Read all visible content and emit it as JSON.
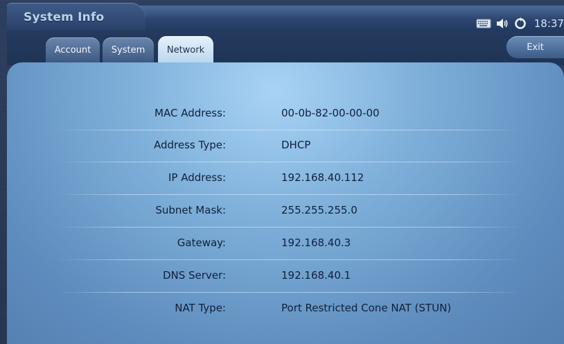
{
  "window": {
    "title": "System Info",
    "time": "18:37",
    "status_icons": [
      "keyboard-icon",
      "speaker-icon",
      "sync-icon"
    ]
  },
  "tabs": [
    {
      "label": "Account",
      "active": false
    },
    {
      "label": "System",
      "active": false
    },
    {
      "label": "Network",
      "active": true
    }
  ],
  "exit_label": "Exit",
  "network": {
    "rows": [
      {
        "label": "MAC Address:",
        "value": "00-0b-82-00-00-00"
      },
      {
        "label": "Address Type:",
        "value": "DHCP"
      },
      {
        "label": "IP Address:",
        "value": "192.168.40.112"
      },
      {
        "label": "Subnet Mask:",
        "value": "255.255.255.0"
      },
      {
        "label": "Gateway:",
        "value": "192.168.40.3"
      },
      {
        "label": "DNS Server:",
        "value": "192.168.40.1"
      },
      {
        "label": "NAT Type:",
        "value": "Port Restricted Cone NAT (STUN)"
      }
    ]
  },
  "colors": {
    "accent": "#2d4670",
    "panel": "#7fb0da",
    "text": "#10203a"
  }
}
